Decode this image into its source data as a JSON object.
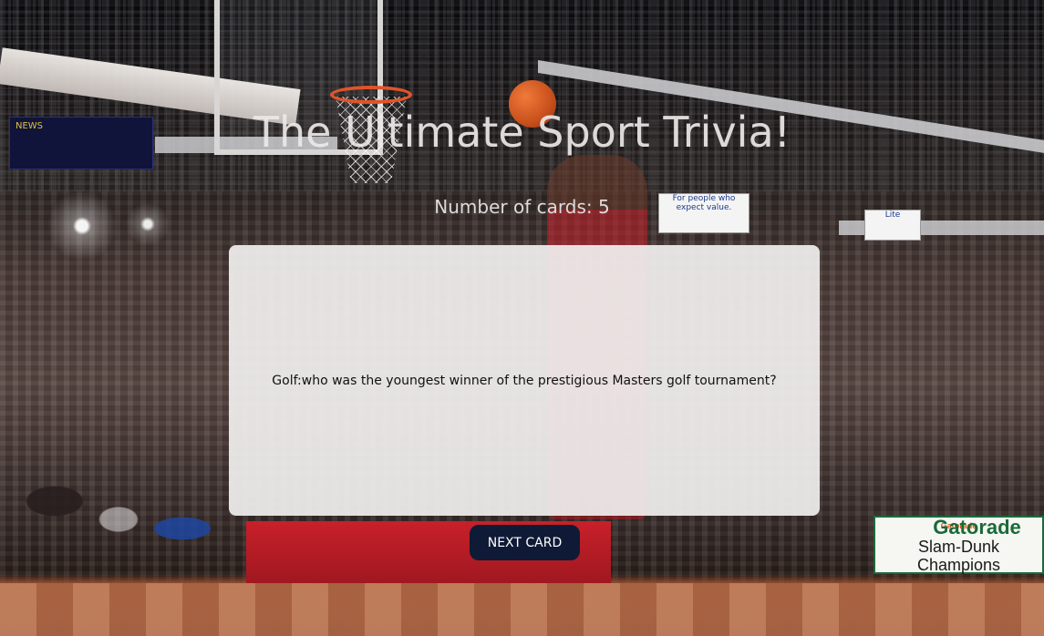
{
  "page": {
    "title": "The Ultimate Sport Trivia!",
    "card_count_label": "Number of cards:",
    "card_count": "5"
  },
  "card": {
    "question": "Golf:who was the youngest winner of the prestigious Masters golf tournament?"
  },
  "controls": {
    "next_label": "NEXT CARD"
  },
  "background": {
    "scoreboard_text": "NEWS",
    "sign_one_text": "For people who expect value.",
    "sign_two_text": "Lite",
    "gatorade_logo": "Gatorade",
    "gatorade_main": "Gatorade",
    "gatorade_sub": "Slam-Dunk Champions"
  },
  "colors": {
    "card_background": "#f0eeee",
    "button_background": "#0e1a36",
    "button_text": "#ffffff",
    "heading_text": "#ece8e8"
  }
}
